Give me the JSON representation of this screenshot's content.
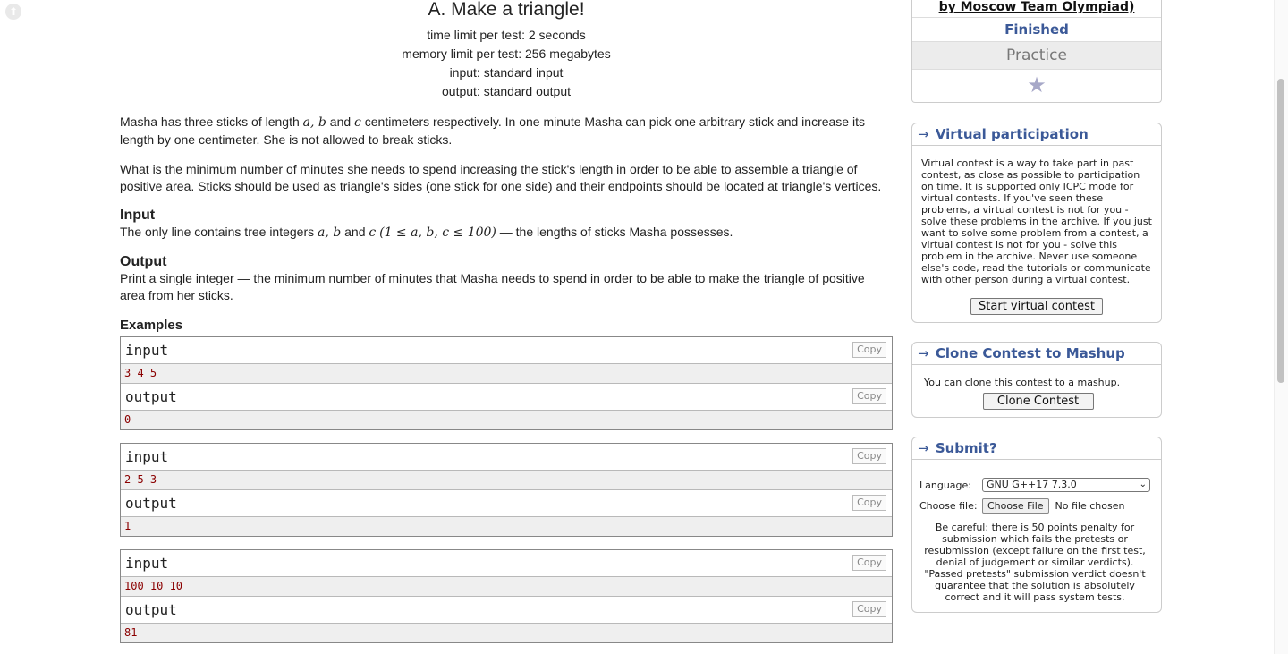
{
  "problem": {
    "title": "A. Make a triangle!",
    "time_limit": "time limit per test: 2 seconds",
    "memory_limit": "memory limit per test: 256 megabytes",
    "input": "input: standard input",
    "output": "output: standard output",
    "statement_1a": "Masha has three sticks of length ",
    "statement_1_vars": "a, b",
    "statement_1b": " and ",
    "statement_1_var_c": "c",
    "statement_1c": " centimeters respectively. In one minute Masha can pick one arbitrary stick and increase its length by one centimeter. She is not allowed to break sticks.",
    "statement_2": "What is the minimum number of minutes she needs to spend increasing the stick's length in order to be able to assemble a triangle of positive area. Sticks should be used as triangle's sides (one stick for one side) and their endpoints should be located at triangle's vertices.",
    "input_title": "Input",
    "input_text_a": "The only line contains tree integers ",
    "input_vars_ab": "a, b",
    "input_text_b": " and ",
    "input_var_c": "c",
    "input_constraint": "(1 ≤ a, b, c ≤ 100)",
    "input_text_c": " — the lengths of sticks Masha possesses.",
    "output_title": "Output",
    "output_text": "Print a single integer — the minimum number of minutes that Masha needs to spend in order to be able to make the triangle of positive area from her sticks.",
    "examples_title": "Examples",
    "input_label": "input",
    "output_label": "output",
    "copy_label": "Copy",
    "examples": [
      {
        "input": "3 4 5",
        "output": "0"
      },
      {
        "input": "2 5 3",
        "output": "1"
      },
      {
        "input": "100 10 10",
        "output": "81"
      }
    ]
  },
  "sidebar": {
    "contest_name": "by Moscow Team Olympiad)",
    "status": "Finished",
    "practice": "Practice",
    "virtual": {
      "title": "Virtual participation",
      "text": "Virtual contest is a way to take part in past contest, as close as possible to participation on time. It is supported only ICPC mode for virtual contests. If you've seen these problems, a virtual contest is not for you - solve these problems in the archive. If you just want to solve some problem from a contest, a virtual contest is not for you - solve this problem in the archive. Never use someone else's code, read the tutorials or communicate with other person during a virtual contest.",
      "button": "Start virtual contest"
    },
    "clone": {
      "title": "Clone Contest to Mashup",
      "text": "You can clone this contest to a mashup.",
      "button": "Clone Contest"
    },
    "submit": {
      "title": "Submit?",
      "language_label": "Language:",
      "language_value": "GNU G++17 7.3.0",
      "file_label": "Choose file:",
      "file_button": "Choose File",
      "file_status": "No file chosen",
      "note": "Be careful: there is 50 points penalty for submission which fails the pretests or resubmission (except failure on the first test, denial of judgement or similar verdicts). \"Passed pretests\" submission verdict doesn't guarantee that the solution is absolutely correct and it will pass system tests."
    }
  }
}
